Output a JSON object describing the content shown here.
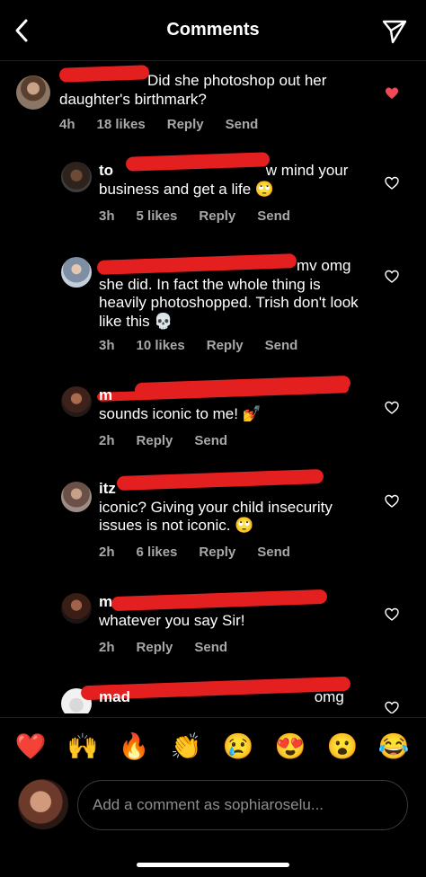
{
  "header": {
    "title": "Comments"
  },
  "comments": [
    {
      "user": "",
      "text": "Did she photoshop out her daughter's birthmark?",
      "time": "4h",
      "likes": "18 likes",
      "reply": "Reply",
      "send": "Send",
      "liked": true
    },
    {
      "user": "to",
      "text": "w mind your business and get a life 🙄",
      "time": "3h",
      "likes": "5 likes",
      "reply": "Reply",
      "send": "Send",
      "liked": false
    },
    {
      "user": "",
      "text": "mv omg she did. In fact the whole thing is heavily photoshopped. Trish don't look like this 💀",
      "time": "3h",
      "likes": "10 likes",
      "reply": "Reply",
      "send": "Send",
      "liked": false
    },
    {
      "user": "m",
      "text": "sounds iconic to me! 💅",
      "time": "2h",
      "likes": "",
      "reply": "Reply",
      "send": "Send",
      "liked": false
    },
    {
      "user": "itz",
      "text": "iconic? Giving your child insecurity issues is not iconic. 🙄",
      "time": "2h",
      "likes": "6 likes",
      "reply": "Reply",
      "send": "Send",
      "liked": false
    },
    {
      "user": "m",
      "text": "whatever you say Sir!",
      "time": "2h",
      "likes": "",
      "reply": "Reply",
      "send": "Send",
      "liked": false
    },
    {
      "user": "mad",
      "text": "omg",
      "time": "",
      "likes": "",
      "reply": "",
      "send": "",
      "liked": false
    }
  ],
  "emojis": [
    "❤️",
    "🙌",
    "🔥",
    "👏",
    "😢",
    "😍",
    "😮",
    "😂"
  ],
  "composer": {
    "placeholder": "Add a comment as sophiaroselu..."
  },
  "colors": {
    "background": "#000000",
    "liked_heart": "#ed4956",
    "redaction": "#e3201f",
    "meta_text": "#a8a8a8"
  }
}
